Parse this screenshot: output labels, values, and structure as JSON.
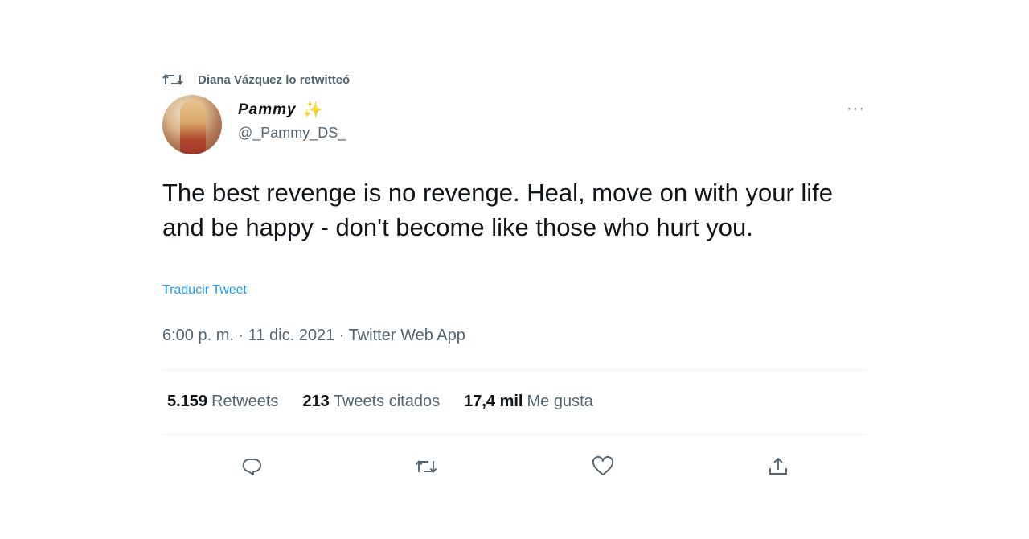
{
  "retweet_banner": {
    "text": "Diana Vázquez lo retwitteó",
    "icon": "retweet-icon"
  },
  "author": {
    "display_name": "Pammy",
    "emoji": "✨",
    "handle": "@_Pammy_DS_"
  },
  "more_menu": {
    "label": "···"
  },
  "tweet": {
    "text": "The best revenge is no revenge. Heal, move on with your life and be happy - don't become like those who hurt you.",
    "translate_link": "Traducir Tweet",
    "meta": "6:00 p. m. · 11 dic. 2021 · Twitter Web App"
  },
  "stats": {
    "retweets": {
      "count": "5.159",
      "label": "Retweets"
    },
    "quotes": {
      "count": "213",
      "label": "Tweets citados"
    },
    "likes": {
      "count": "17,4 mil",
      "label": "Me gusta"
    }
  },
  "actions": {
    "reply": "reply-icon",
    "retweet": "retweet-icon",
    "like": "heart-icon",
    "share": "share-icon"
  },
  "colors": {
    "accent": "#1d9bf0",
    "muted": "#536471",
    "text": "#0f1419"
  }
}
